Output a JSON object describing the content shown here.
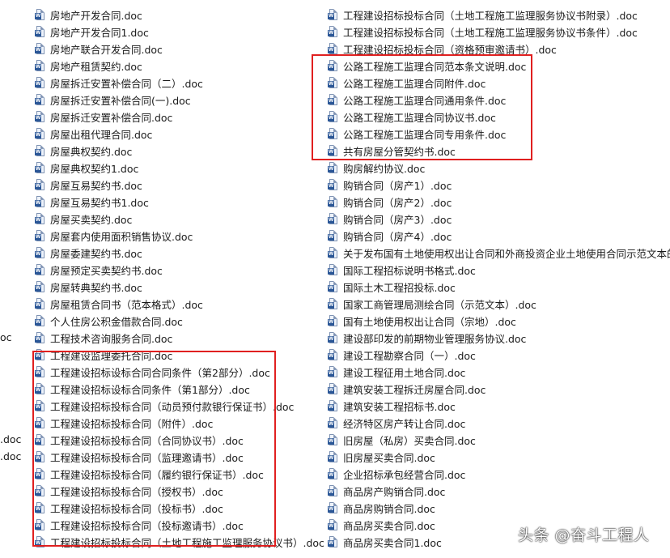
{
  "left_files": [
    "房地产开发合同.doc",
    "房地产开发合同1.doc",
    "房地产联合开发合同.doc",
    "房地产租赁契约.doc",
    "房屋拆迁安置补偿合同（二）.doc",
    "房屋拆迁安置补偿合同(一).doc",
    "房屋拆迁安置补偿合同.doc",
    "房屋出租代理合同.doc",
    "房屋典权契约.doc",
    "房屋典权契约1.doc",
    "房屋互易契约书.doc",
    "房屋互易契约书1.doc",
    "房屋买卖契约.doc",
    "房屋套内使用面积销售协议.doc",
    "房屋委建契约书.doc",
    "房屋预定买卖契约书.doc",
    "房屋转典契约书.doc",
    "房屋租赁合同书（范本格式）.doc",
    "个人住房公积金借款合同.doc",
    "工程技术咨询服务合同.doc",
    "工程建设监理委托合同.doc",
    "工程建设招标设标合同合同条件（第2部分）.doc",
    "工程建设招标设标合同条件（第1部分）.doc",
    "工程建设招标投标合同（动员预付款银行保证书）.doc",
    "工程建设招标投标合同（附件）.doc",
    "工程建设招标投标合同（合同协议书）.doc",
    "工程建设招标投标合同（监理邀请书）.doc",
    "工程建设招标投标合同（履约银行保证书）.doc",
    "工程建设招标投标合同（授权书）.doc",
    "工程建设招标投标合同（投标书）.doc",
    "工程建设招标投标合同（投标邀请书）.doc",
    "工程建设招标投标合同（土地工程施工监理服务协议书）.doc"
  ],
  "right_files": [
    "工程建设招标投标合同（土地工程施工监理服务协议书附录）.doc",
    "工程建设招标投标合同（土地工程施工监理服务协议书条件）.doc",
    "工程建设招标投标合同（资格预审邀请书）.doc",
    "公路工程施工监理合同范本条文说明.doc",
    "公路工程施工监理合同附件.doc",
    "公路工程施工监理合同通用条件.doc",
    "公路工程施工监理合同协议书.doc",
    "公路工程施工监理合同专用条件.doc",
    "共有房屋分管契约书.doc",
    "购房解约协议.doc",
    "购销合同（房产1）.doc",
    "购销合同（房产2）.doc",
    "购销合同（房产3）.doc",
    "购销合同（房产4）.doc",
    "关于发布国有土地使用权出让合同和外商投资企业土地使用合同示范文本的通知",
    "国际工程招标说明书格式.doc",
    "国际土木工程招投标.doc",
    "国家工商管理局测绘合同（示范文本）.doc",
    "国有土地使用权出让合同（宗地）.doc",
    "建设部印发的前期物业管理服务协议.doc",
    "建设工程勘察合同（一）.doc",
    "建设工程征用土地合同.doc",
    "建筑安装工程拆迁房屋合同.doc",
    "建筑安装工程招标书.doc",
    "经济特区房产转让合同.doc",
    "旧房屋（私房）买卖合同.doc",
    "旧房屋买卖合同.doc",
    "企业招标承包经营合同.doc",
    "商品房产购销合同.doc",
    "商品房购销合同.doc",
    "商品房买卖合同.doc",
    "商品房买卖合同1.doc"
  ],
  "edge_fragments": [
    {
      "text": "oc"
    },
    {
      "text": ".doc"
    },
    {
      "text": ".doc"
    }
  ],
  "icon": {
    "letter": "W"
  },
  "watermark": "头条 @奋斗工程人",
  "highlight_color": "#e02020"
}
